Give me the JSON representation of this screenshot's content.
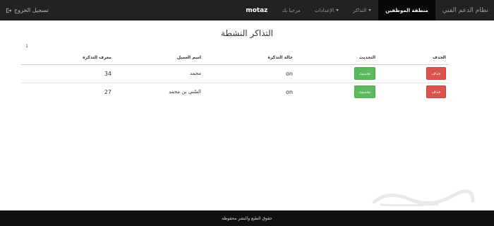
{
  "navbar": {
    "brand": "نظام الدعم الفني",
    "items": [
      {
        "label": "منطقة الموظفين",
        "active": true,
        "dropdown": false
      },
      {
        "label": "التذاكر",
        "active": false,
        "dropdown": true
      },
      {
        "label": "الإعدادات",
        "active": false,
        "dropdown": true
      },
      {
        "label": "مرحبا بك",
        "active": false,
        "dropdown": false
      }
    ],
    "user": "motaz",
    "logout_label": "تسجيل الخروج",
    "logout_icon": "logout-icon"
  },
  "main": {
    "title": "التذاكر النشطة",
    "count": "1",
    "table": {
      "headers": [
        "الحذف",
        "التحديث",
        "حالة التذكرة",
        "اسم العميل",
        "معرف التذكرة"
      ],
      "rows": [
        {
          "delete": "حذف",
          "update": "تحديث",
          "state": "on",
          "customer": "محمد",
          "id": "34"
        },
        {
          "delete": "حذف",
          "update": "تحديث",
          "state": "on",
          "customer": "السّني بن محمد",
          "id": "27"
        }
      ]
    }
  },
  "footer": {
    "text": "حقوق الطبع والنشر محفوظة"
  },
  "colors": {
    "navbar": "#222222",
    "danger": "#d9534f",
    "success": "#5cb85c",
    "footer": "#111111"
  }
}
